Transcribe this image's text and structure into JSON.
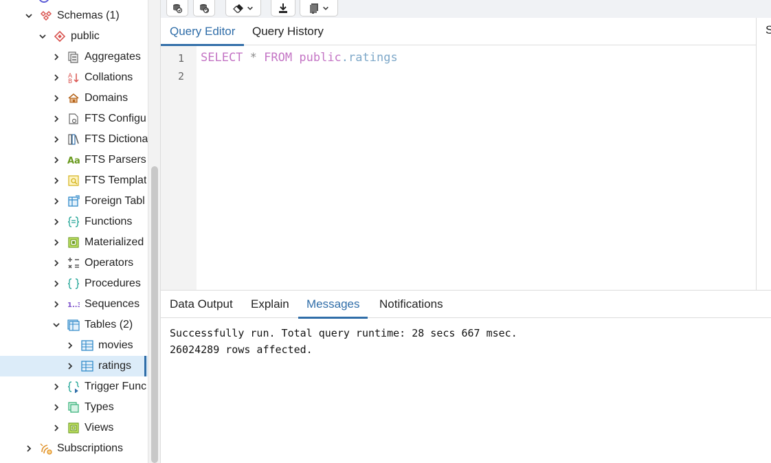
{
  "tree": {
    "rows": [
      {
        "label": "Schemas (1)",
        "icon": "schemas-icon",
        "expanded": true
      },
      {
        "label": "public",
        "icon": "schema-icon",
        "expanded": true
      },
      {
        "label": "Aggregates",
        "icon": "aggregates-icon"
      },
      {
        "label": "Collations",
        "icon": "collations-icon"
      },
      {
        "label": "Domains",
        "icon": "domains-icon"
      },
      {
        "label": "FTS Configu",
        "icon": "fts-configurations-icon"
      },
      {
        "label": "FTS Dictiona",
        "icon": "fts-dictionaries-icon"
      },
      {
        "label": "FTS Parsers",
        "icon": "fts-parsers-icon"
      },
      {
        "label": "FTS Templat",
        "icon": "fts-templates-icon"
      },
      {
        "label": "Foreign Tabl",
        "icon": "foreign-tables-icon"
      },
      {
        "label": "Functions",
        "icon": "functions-icon"
      },
      {
        "label": "Materialized",
        "icon": "materialized-views-icon"
      },
      {
        "label": "Operators",
        "icon": "operators-icon"
      },
      {
        "label": "Procedures",
        "icon": "procedures-icon"
      },
      {
        "label": "Sequences",
        "icon": "sequences-icon"
      },
      {
        "label": "Tables (2)",
        "icon": "tables-icon",
        "expanded": true
      },
      {
        "label": "movies",
        "icon": "table-icon"
      },
      {
        "label": "ratings",
        "icon": "table-icon",
        "selected": true
      },
      {
        "label": "Trigger Func",
        "icon": "trigger-functions-icon"
      },
      {
        "label": "Types",
        "icon": "types-icon"
      },
      {
        "label": "Views",
        "icon": "views-icon"
      },
      {
        "label": "Subscriptions",
        "icon": "subscriptions-icon"
      }
    ]
  },
  "editor_tabs": {
    "query_editor": "Query Editor",
    "query_history": "Query History"
  },
  "side_panel": {
    "tab_label": "S"
  },
  "editor": {
    "line_numbers": [
      "1",
      "2"
    ],
    "code": {
      "kw1": "SELECT",
      "star": "*",
      "kw2": "FROM",
      "schema": "public",
      "dot_table": ".ratings"
    }
  },
  "results_tabs": {
    "data_output": "Data Output",
    "explain": "Explain",
    "messages": "Messages",
    "notifications": "Notifications"
  },
  "messages": {
    "line1": "Successfully run. Total query runtime: 28 secs 667 msec.",
    "line2": "26024289 rows affected."
  },
  "colors": {
    "accent": "#2f6da8",
    "selected_row": "#dcecf9",
    "keyword": "#c475c5",
    "identifier_tail": "#7ea8c9"
  }
}
